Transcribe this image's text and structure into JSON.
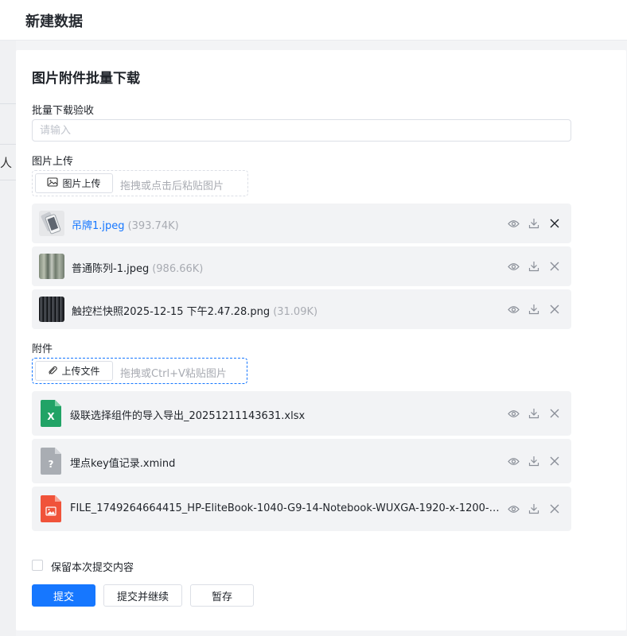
{
  "header": {
    "title": "新建数据"
  },
  "background": {
    "cut_text": "人"
  },
  "form": {
    "title": "图片附件批量下载",
    "field_text": {
      "label": "批量下载验收",
      "placeholder": "请输入"
    },
    "image_upload": {
      "label": "图片上传",
      "button_label": "图片上传",
      "hint": "拖拽或点击后粘贴图片",
      "files": [
        {
          "name": "吊牌1.jpeg",
          "size": "(393.74K)",
          "link": true
        },
        {
          "name": "普通陈列-1.jpeg",
          "size": "(986.66K)",
          "link": false
        },
        {
          "name": "触控栏快照2025-12-15 下午2.47.28.png",
          "size": "(31.09K)",
          "link": false
        }
      ]
    },
    "attachment": {
      "label": "附件",
      "button_label": "上传文件",
      "hint": "拖拽或Ctrl+V粘贴图片",
      "files": [
        {
          "name": "级联选择组件的导入导出_20251211143631.xlsx",
          "icon": "excel-file-icon",
          "color": "#21a366",
          "glyph": "X"
        },
        {
          "name": "埋点key值记录.xmind",
          "icon": "unknown-file-icon",
          "color": "#a9adb3",
          "glyph": "?"
        },
        {
          "name": "FILE_1749264664415_HP-EliteBook-1040-G9-14-Notebook-WUXGA-1920-x-1200-l...",
          "icon": "image-file-icon",
          "color": "#f0533a",
          "glyph": ""
        }
      ]
    },
    "keep_content": {
      "label": "保留本次提交内容",
      "checked": false
    },
    "buttons": {
      "submit": "提交",
      "submit_continue": "提交并继续",
      "save_draft": "暂存"
    }
  },
  "colors": {
    "primary": "#1677ff",
    "row_bg": "#f2f3f5",
    "placeholder": "#a8abb2"
  }
}
